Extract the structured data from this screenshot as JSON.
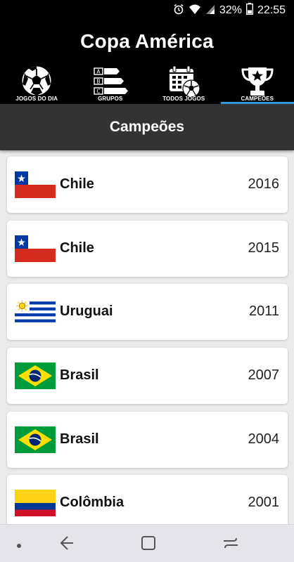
{
  "status_bar": {
    "battery": "32%",
    "time": "22:55",
    "icons": [
      "alarm-icon",
      "wifi-icon",
      "signal-icon",
      "battery-icon"
    ]
  },
  "app": {
    "title": "Copa América"
  },
  "tabs": [
    {
      "label": "JOGOS DO DIA",
      "icon": "soccer-ball-icon",
      "active": false
    },
    {
      "label": "GRUPOS",
      "icon": "groups-icon",
      "active": false,
      "group_letters": [
        "A",
        "B",
        "C"
      ]
    },
    {
      "label": "TODOS JOGOS",
      "icon": "calendar-ball-icon",
      "active": false
    },
    {
      "label": "CAMPEÕES",
      "icon": "trophy-icon",
      "active": true
    }
  ],
  "section": {
    "title": "Campeões"
  },
  "champions": [
    {
      "country": "Chile",
      "year": "2016",
      "flag": "chile-flag-icon"
    },
    {
      "country": "Chile",
      "year": "2015",
      "flag": "chile-flag-icon"
    },
    {
      "country": "Uruguai",
      "year": "2011",
      "flag": "uruguay-flag-icon"
    },
    {
      "country": "Brasil",
      "year": "2007",
      "flag": "brazil-flag-icon"
    },
    {
      "country": "Brasil",
      "year": "2004",
      "flag": "brazil-flag-icon"
    },
    {
      "country": "Colômbia",
      "year": "2001",
      "flag": "colombia-flag-icon"
    }
  ],
  "colors": {
    "app_bar": "#000000",
    "section_header": "#333333",
    "active_tab_indicator": "#3a9ad9",
    "background": "#ebebeb"
  },
  "nav_bar": {
    "icons": [
      "dot-icon",
      "back-icon",
      "home-icon",
      "recents-icon"
    ]
  }
}
